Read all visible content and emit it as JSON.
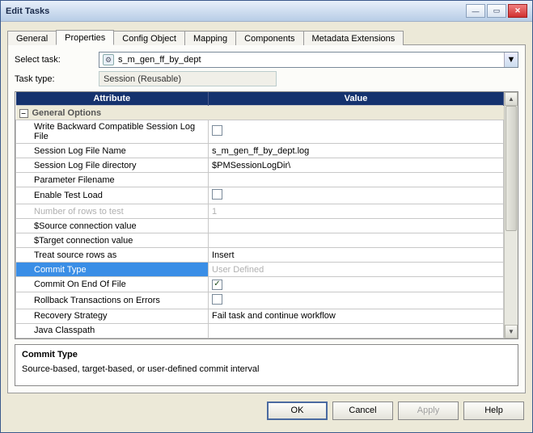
{
  "window": {
    "title": "Edit Tasks"
  },
  "tabs": {
    "general": "General",
    "properties": "Properties",
    "config": "Config Object",
    "mapping": "Mapping",
    "components": "Components",
    "metadata": "Metadata Extensions"
  },
  "form": {
    "select_label": "Select task:",
    "select_value": "s_m_gen_ff_by_dept",
    "type_label": "Task type:",
    "type_value": "Session (Reusable)"
  },
  "grid": {
    "col_attr": "Attribute",
    "col_val": "Value",
    "section": "General Options",
    "rows": {
      "r1": {
        "attr": "Write Backward Compatible Session Log File"
      },
      "r2": {
        "attr": "Session Log File Name",
        "val": "s_m_gen_ff_by_dept.log"
      },
      "r3": {
        "attr": "Session Log File directory",
        "val": "$PMSessionLogDir\\"
      },
      "r4": {
        "attr": "Parameter Filename"
      },
      "r5": {
        "attr": "Enable Test Load"
      },
      "r6": {
        "attr": "Number of rows to test",
        "val": "1"
      },
      "r7": {
        "attr": "$Source connection value"
      },
      "r8": {
        "attr": "$Target connection value"
      },
      "r9": {
        "attr": "Treat source rows as",
        "val": "Insert"
      },
      "r10": {
        "attr": "Commit Type",
        "val": "User Defined"
      },
      "r11": {
        "attr": "Commit On End Of File"
      },
      "r12": {
        "attr": "Rollback Transactions on Errors"
      },
      "r13": {
        "attr": "Recovery Strategy",
        "val": "Fail task and continue workflow"
      },
      "r14": {
        "attr": "Java Classpath"
      }
    }
  },
  "desc": {
    "title": "Commit Type",
    "text": "Source-based, target-based, or user-defined commit interval"
  },
  "buttons": {
    "ok": "OK",
    "cancel": "Cancel",
    "apply": "Apply",
    "help": "Help"
  }
}
